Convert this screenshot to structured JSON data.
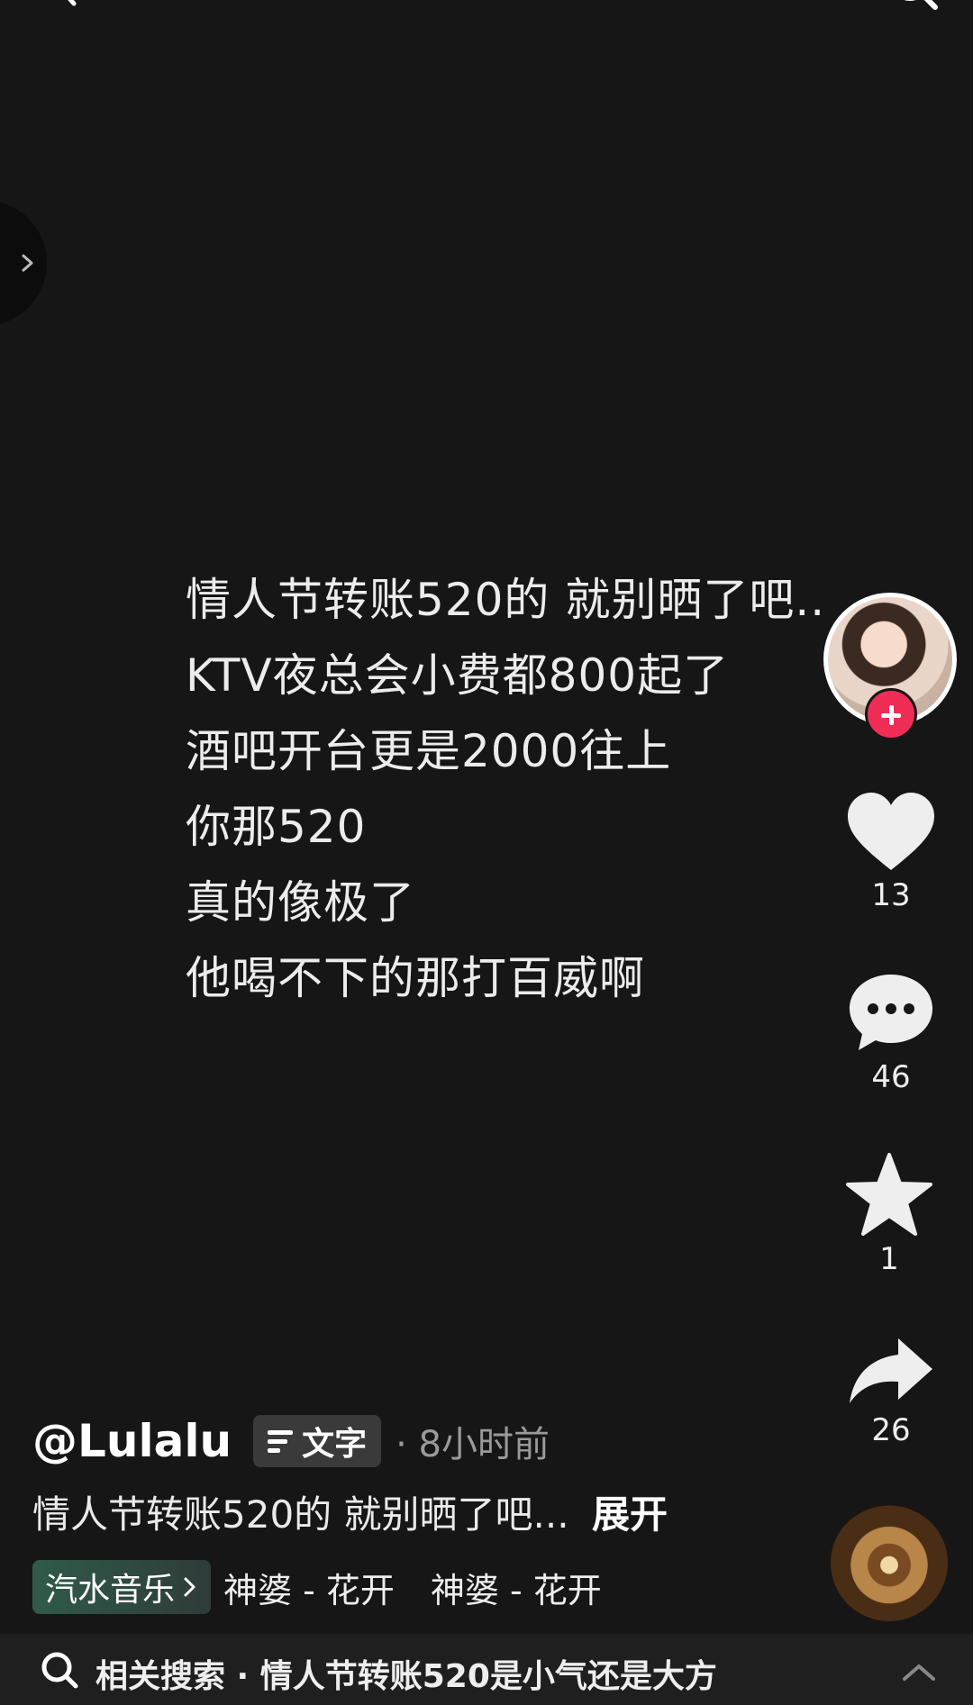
{
  "caption": {
    "lines": [
      "情人节转账520的 就别晒了吧..",
      "KTV夜总会小费都800起了",
      "酒吧开台更是2000往上",
      "你那520",
      "真的像极了",
      "他喝不下的那打百威啊"
    ]
  },
  "actions": {
    "like_count": "13",
    "comment_count": "46",
    "favorite_count": "1",
    "share_count": "26"
  },
  "post": {
    "author": "@Lulalu",
    "type_label": "文字",
    "time": "· 8小时前",
    "description": "情人节转账520的  就别晒了吧...",
    "expand_label": "展开"
  },
  "music": {
    "app_label": "汽水音乐",
    "track_1": "神婆 - 花开",
    "track_2": "神婆 - 花开"
  },
  "related_search": {
    "text": "相关搜索 · 情人节转账520是小气还是大方"
  },
  "colors": {
    "background": "#161616",
    "follow_accent": "#f02d56",
    "chip_bg": "#3a3a3a"
  }
}
